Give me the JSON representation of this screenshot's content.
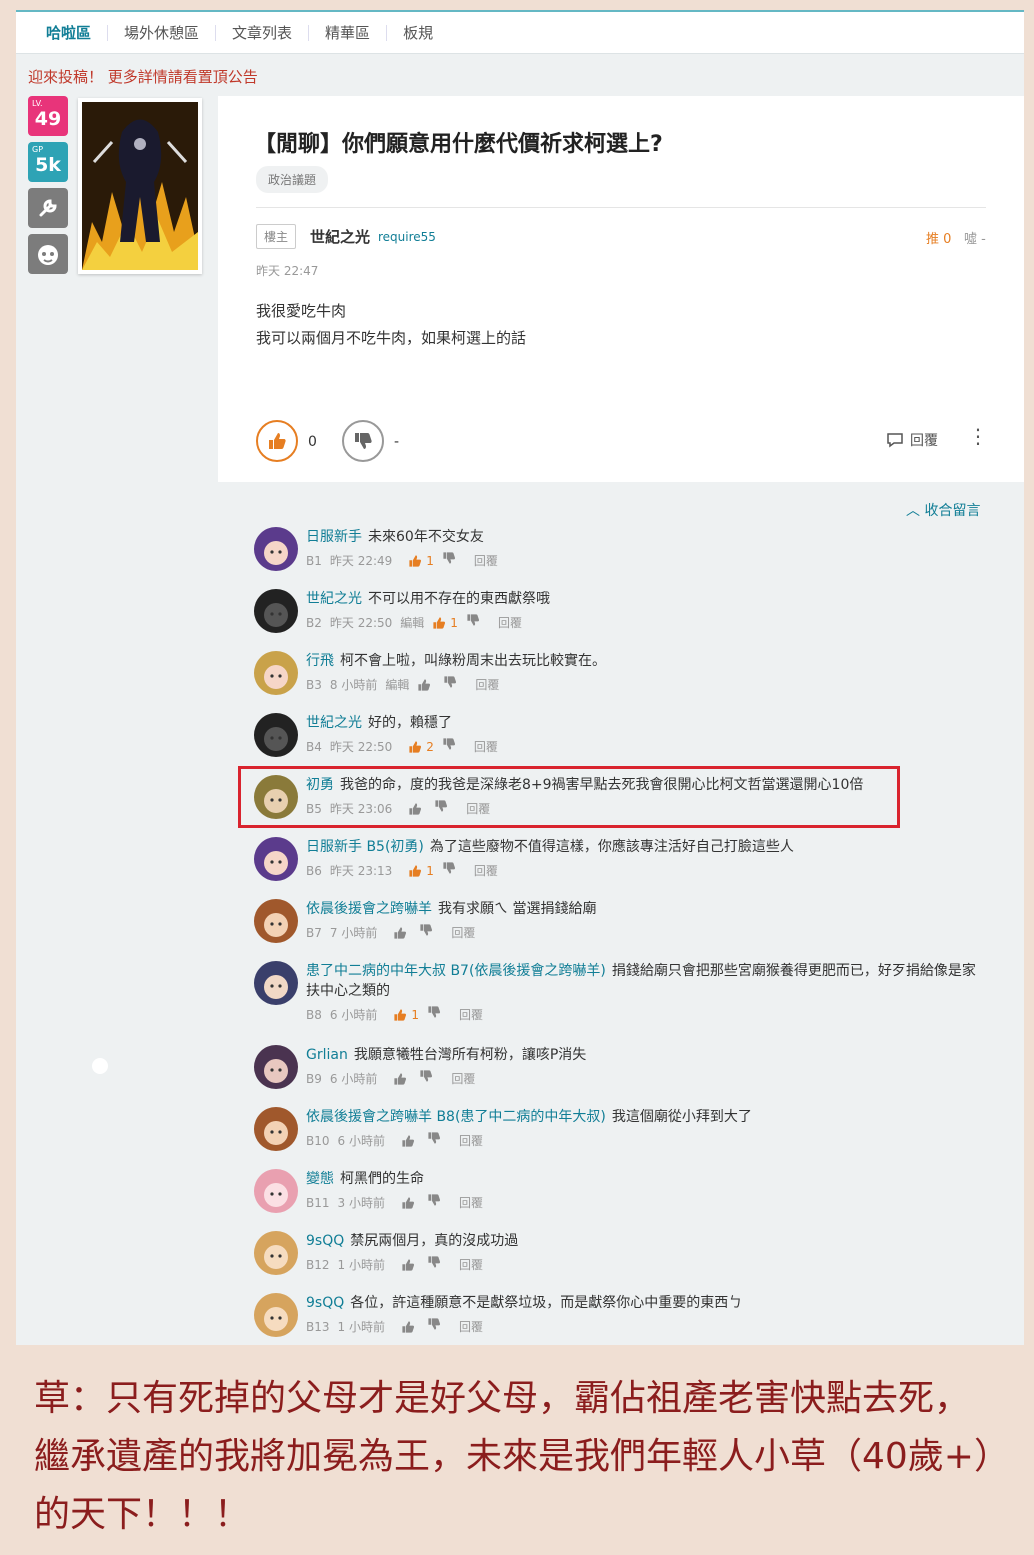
{
  "nav": {
    "items": [
      "哈啦區",
      "場外休憩區",
      "文章列表",
      "精華區",
      "板規"
    ]
  },
  "notice": "迎來投稿！ 更多詳情請看置頂公告",
  "side": {
    "lv_label": "LV.",
    "lv": "49",
    "gp_label": "GP",
    "gp": "5k"
  },
  "post": {
    "title": "【閒聊】你們願意用什麼代價祈求柯選上?",
    "tag": "政治議題",
    "floor": "樓主",
    "author": "世紀之光",
    "author_id": "require55",
    "push": "推 0",
    "boo": "噓 -",
    "time": "昨天 22:47",
    "body": [
      "我很愛吃牛肉",
      "我可以兩個月不吃牛肉，如果柯選上的話"
    ],
    "likes": "0",
    "dislikes": "-",
    "reply": "回覆"
  },
  "collapse": "收合留言",
  "comments": [
    {
      "name": "日服新手",
      "text": "未來60年不交女友",
      "floor": "B1",
      "time": "昨天 22:49",
      "edit": "",
      "likes": "1",
      "reply": "回覆"
    },
    {
      "name": "世紀之光",
      "text": "不可以用不存在的東西獻祭哦",
      "floor": "B2",
      "time": "昨天 22:50",
      "edit": "編輯",
      "likes": "1",
      "reply": "回覆"
    },
    {
      "name": "行飛",
      "text": "柯不會上啦，叫綠粉周末出去玩比較實在。",
      "floor": "B3",
      "time": "8 小時前",
      "edit": "編輯",
      "likes": "",
      "reply": "回覆"
    },
    {
      "name": "世紀之光",
      "text": "好的，賴穩了",
      "floor": "B4",
      "time": "昨天 22:50",
      "edit": "",
      "likes": "2",
      "reply": "回覆"
    },
    {
      "name": "初勇",
      "text": "我爸的命，度的我爸是深綠老8+9禍害早點去死我會很開心比柯文哲當選還開心10倍",
      "floor": "B5",
      "time": "昨天 23:06",
      "edit": "",
      "likes": "",
      "reply": "回覆"
    },
    {
      "name": "日服新手 B5(初勇)",
      "text": "為了這些廢物不值得這樣，你應該專注活好自己打臉這些人",
      "floor": "B6",
      "time": "昨天 23:13",
      "edit": "",
      "likes": "1",
      "reply": "回覆"
    },
    {
      "name": "依晨後援會之跨嚇羊",
      "text": "我有求願ㄟ 當選捐錢給廟",
      "floor": "B7",
      "time": "7 小時前",
      "edit": "",
      "likes": "",
      "reply": "回覆"
    },
    {
      "name": "患了中二病的中年大叔 B7(依晨後援會之跨嚇羊)",
      "text": "捐錢給廟只會把那些宮廟猴養得更肥而已，好歹捐給像是家扶中心之類的",
      "floor": "B8",
      "time": "6 小時前",
      "edit": "",
      "likes": "1",
      "reply": "回覆"
    },
    {
      "name": "Grlian",
      "text": "我願意犧牲台灣所有柯粉，讓咳P消失",
      "floor": "B9",
      "time": "6 小時前",
      "edit": "",
      "likes": "",
      "reply": "回覆"
    },
    {
      "name": "依晨後援會之跨嚇羊 B8(患了中二病的中年大叔)",
      "text": "我這個廟從小拜到大了",
      "floor": "B10",
      "time": "6 小時前",
      "edit": "",
      "likes": "",
      "reply": "回覆"
    },
    {
      "name": "變態",
      "text": "柯黑們的生命",
      "floor": "B11",
      "time": "3 小時前",
      "edit": "",
      "likes": "",
      "reply": "回覆"
    },
    {
      "name": "9sQQ",
      "text": "禁尻兩個月，真的沒成功過",
      "floor": "B12",
      "time": "1 小時前",
      "edit": "",
      "likes": "",
      "reply": "回覆"
    },
    {
      "name": "9sQQ",
      "text": "各位，許這種願意不是獻祭垃圾，而是獻祭你心中重要的東西ㄅ",
      "floor": "B13",
      "time": "1 小時前",
      "edit": "",
      "likes": "",
      "reply": "回覆"
    }
  ],
  "caption": "草：只有死掉的父母才是好父母，霸佔祖產老害快點去死，繼承遺產的我將加冕為王，未來是我們年輕人小草（40歲+）的天下！！！"
}
